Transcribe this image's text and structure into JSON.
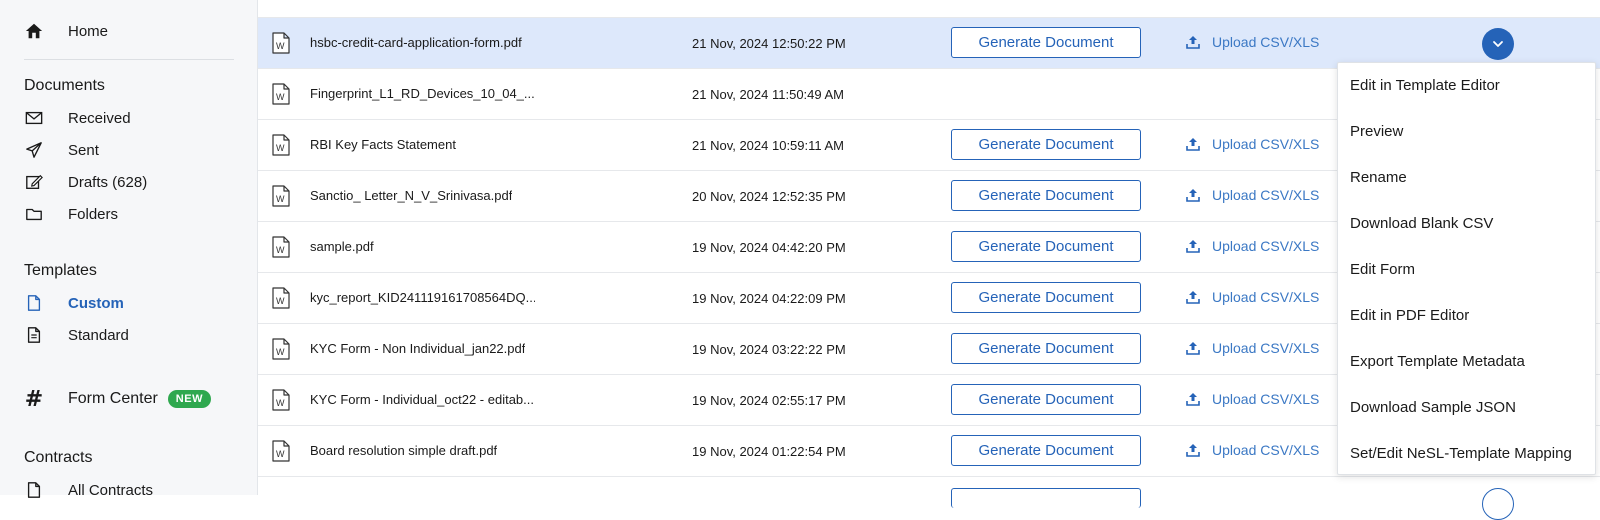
{
  "sidebar": {
    "home": "Home",
    "documents_title": "Documents",
    "received": "Received",
    "sent": "Sent",
    "drafts": "Drafts (628)",
    "folders": "Folders",
    "templates_title": "Templates",
    "custom": "Custom",
    "standard": "Standard",
    "form_center": "Form Center",
    "new_badge": "NEW",
    "contracts_title": "Contracts",
    "all_contracts": "All Contracts"
  },
  "actions": {
    "generate_label": "Generate Document",
    "upload_label": "Upload CSV/XLS"
  },
  "rows": [
    {
      "name": "hsbc-credit-card-application-form.pdf",
      "date": "21 Nov, 2024 12:50:22 PM"
    },
    {
      "name": "Fingerprint_L1_RD_Devices_10_04_...",
      "date": "21 Nov, 2024 11:50:49 AM"
    },
    {
      "name": "RBI Key Facts Statement",
      "date": "21 Nov, 2024 10:59:11 AM"
    },
    {
      "name": "Sanctio_ Letter_N_V_Srinivasa.pdf",
      "date": "20 Nov, 2024 12:52:35 PM"
    },
    {
      "name": "sample.pdf",
      "date": "19 Nov, 2024 04:42:20 PM"
    },
    {
      "name": "kyc_report_KID241119161708564DQ...",
      "date": "19 Nov, 2024 04:22:09 PM"
    },
    {
      "name": "KYC Form - Non Individual_jan22.pdf",
      "date": "19 Nov, 2024 03:22:22 PM"
    },
    {
      "name": "KYC Form - Individual_oct22 - editab...",
      "date": "19 Nov, 2024 02:55:17 PM"
    },
    {
      "name": "Board resolution simple draft.pdf",
      "date": "19 Nov, 2024 01:22:54 PM"
    }
  ],
  "menu": {
    "items": [
      "Edit in Template Editor",
      "Preview",
      "Rename",
      "Download Blank CSV",
      "Edit Form",
      "Edit in PDF Editor",
      "Export Template Metadata",
      "Download Sample JSON",
      "Set/Edit NeSL-Template Mapping"
    ]
  },
  "colors": {
    "accent": "#2563b8",
    "selected_row": "#dde8fb",
    "badge": "#2fa84f"
  }
}
